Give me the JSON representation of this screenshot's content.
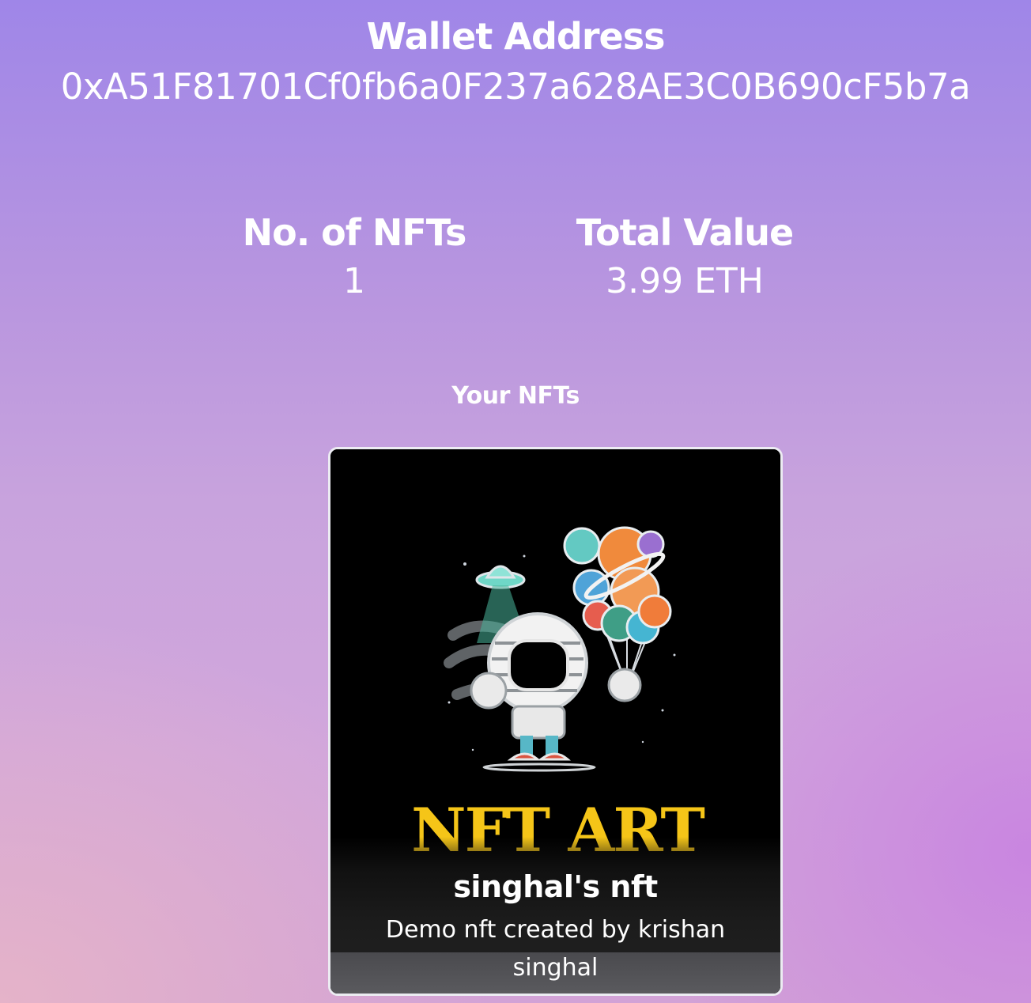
{
  "wallet": {
    "title": "Wallet Address",
    "address": "0xA51F81701Cf0fb6a0F237a628AE3C0B690cF5b7a"
  },
  "stats": {
    "nfts_label": "No. of NFTs",
    "nfts_value": "1",
    "total_label": "Total Value",
    "total_value": "3.99 ETH"
  },
  "section": {
    "title": "Your NFTs"
  },
  "nfts": [
    {
      "image_text": "NFT ART",
      "name": "singhal's nft",
      "description": "Demo nft created by krishan singhal"
    }
  ],
  "colors": {
    "background_top": "#9f86e8",
    "background_bottom": "#d2a2d6",
    "card_background": "#000000",
    "card_border": "#ececf2",
    "art_title_gold": "#f5c518"
  }
}
